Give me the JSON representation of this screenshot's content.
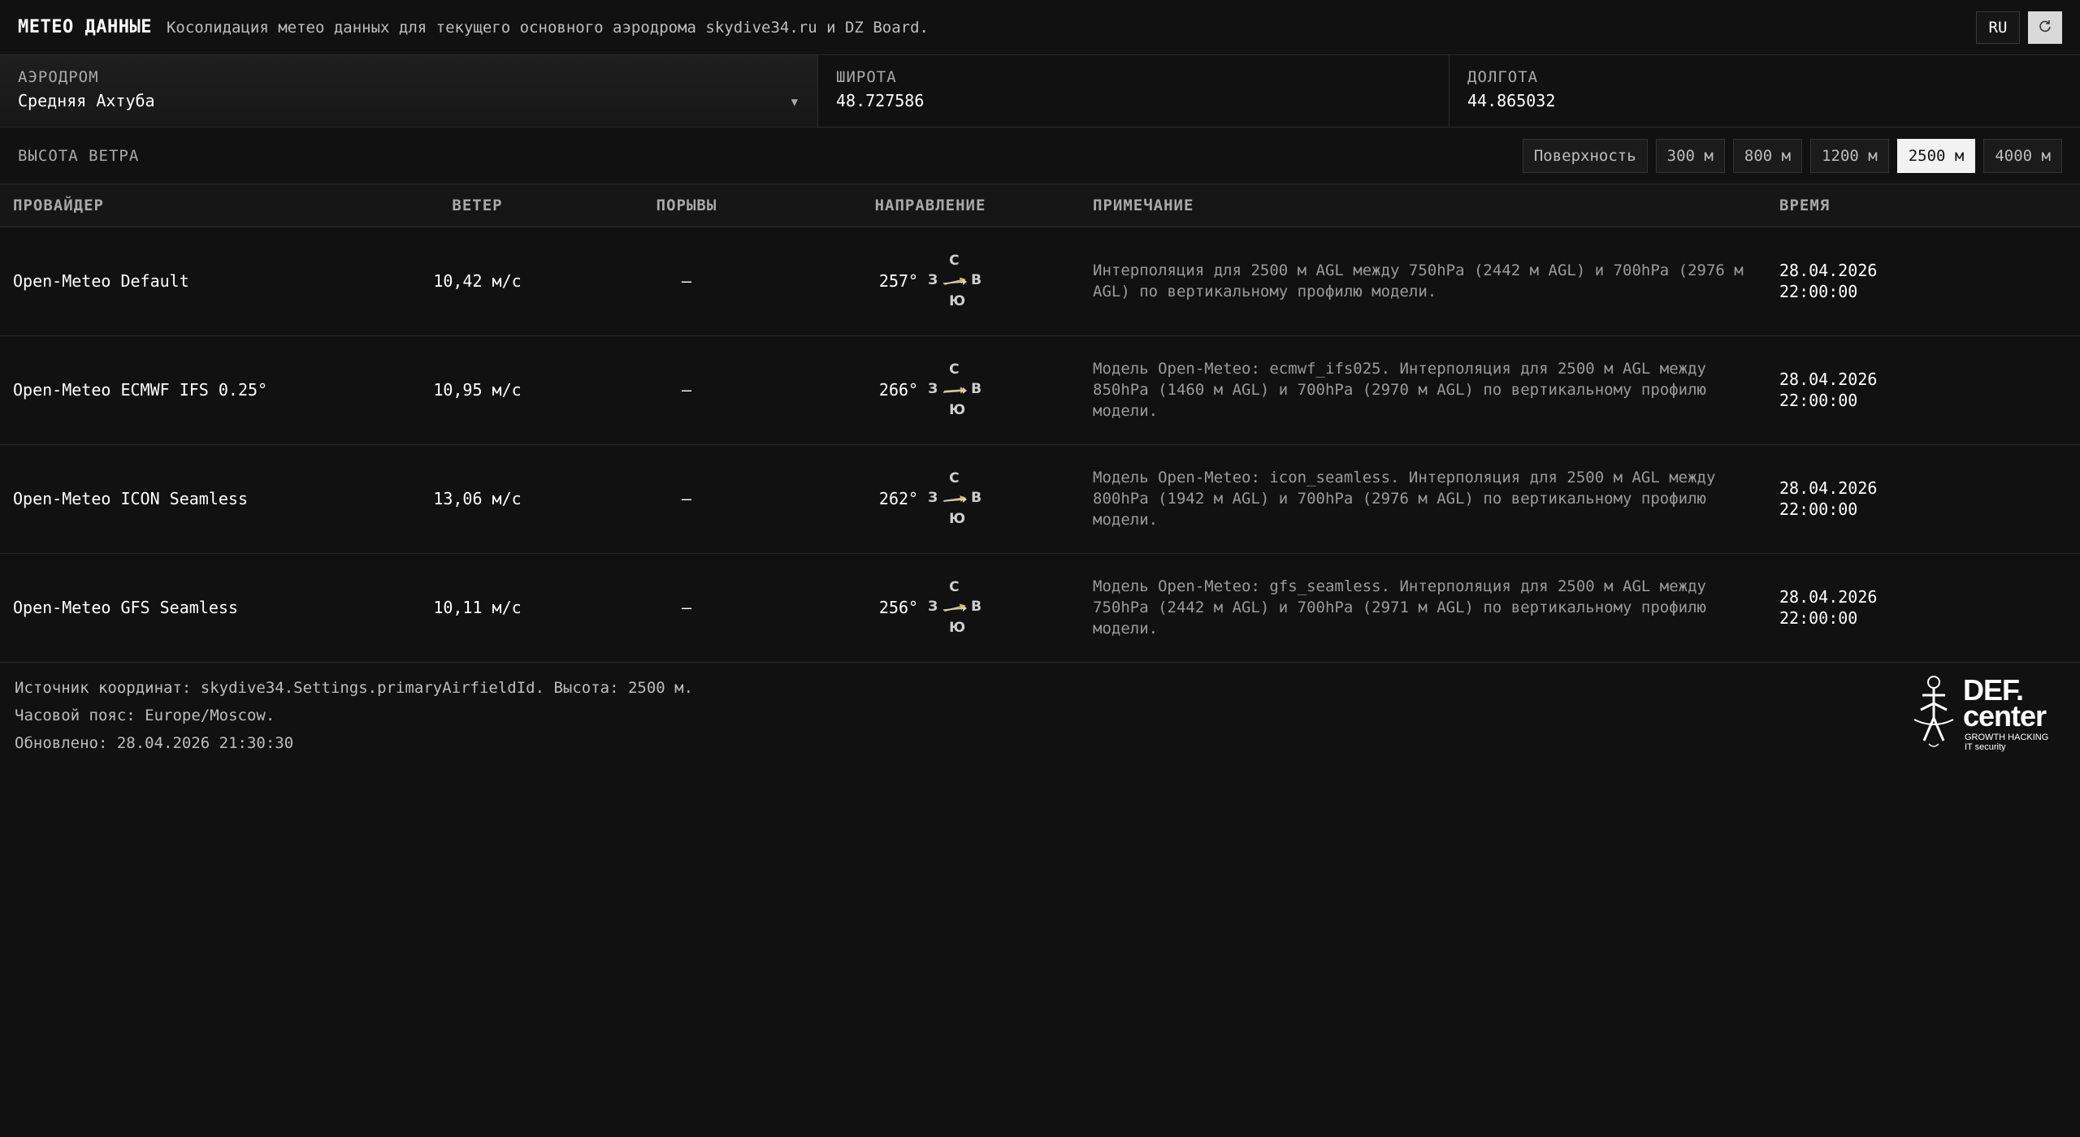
{
  "header": {
    "title": "МЕТЕО ДАННЫЕ",
    "subtitle": "Косолидация метео данных для текущего основного аэродрома skydive34.ru и DZ Board.",
    "lang_button": "RU",
    "refresh_icon": "refresh-icon"
  },
  "location": {
    "airfield_label": "АЭРОДРОМ",
    "airfield_value": "Средняя Ахтуба",
    "latitude_label": "ШИРОТА",
    "latitude_value": "48.727586",
    "longitude_label": "ДОЛГОТА",
    "longitude_value": "44.865032"
  },
  "altitude": {
    "label": "ВЫСОТА ВЕТРА",
    "options": [
      "Поверхность",
      "300 м",
      "800 м",
      "1200 м",
      "2500 м",
      "4000 м"
    ],
    "selected": "2500 м"
  },
  "table": {
    "headers": {
      "provider": "ПРОВАЙДЕР",
      "wind": "ВЕТЕР",
      "gusts": "ПОРЫВЫ",
      "direction": "НАПРАВЛЕНИЕ",
      "note": "ПРИМЕЧАНИЕ",
      "time": "ВРЕМЯ"
    },
    "compass": {
      "n": "С",
      "s": "Ю",
      "w": "З",
      "e": "В"
    },
    "rows": [
      {
        "provider": "Open-Meteo Default",
        "wind": "10,42 м/с",
        "gusts": "—",
        "direction_text": "257°",
        "direction_deg": 257,
        "note": "Интерполяция для 2500 м AGL между 750hPa (2442 м AGL) и 700hPa (2976 м AGL) по вертикальному профилю модели.",
        "date": "28.04.2026",
        "time": "22:00:00"
      },
      {
        "provider": "Open-Meteo ECMWF IFS 0.25°",
        "wind": "10,95 м/с",
        "gusts": "—",
        "direction_text": "266°",
        "direction_deg": 266,
        "note": "Модель Open-Meteo: ecmwf_ifs025. Интерполяция для 2500 м AGL между 850hPa (1460 м AGL) и 700hPa (2970 м AGL) по вертикальному профилю модели.",
        "date": "28.04.2026",
        "time": "22:00:00"
      },
      {
        "provider": "Open-Meteo ICON Seamless",
        "wind": "13,06 м/с",
        "gusts": "—",
        "direction_text": "262°",
        "direction_deg": 262,
        "note": "Модель Open-Meteo: icon_seamless. Интерполяция для 2500 м AGL между 800hPa (1942 м AGL) и 700hPa (2976 м AGL) по вертикальному профилю модели.",
        "date": "28.04.2026",
        "time": "22:00:00"
      },
      {
        "provider": "Open-Meteo GFS Seamless",
        "wind": "10,11 м/с",
        "gusts": "—",
        "direction_text": "256°",
        "direction_deg": 256,
        "note": "Модель Open-Meteo: gfs_seamless. Интерполяция для 2500 м AGL между 750hPa (2442 м AGL) и 700hPa (2971 м AGL) по вертикальному профилю модели.",
        "date": "28.04.2026",
        "time": "22:00:00"
      }
    ]
  },
  "footer": {
    "source": "Источник координат: skydive34.Settings.primaryAirfieldId. Высота: 2500 м.",
    "timezone": "Часовой пояс: Europe/Moscow.",
    "updated": "Обновлено: 28.04.2026 21:30:30"
  },
  "logo": {
    "line1": "DEF.",
    "line2": "center",
    "sub1": "GROWTH HACKING",
    "sub2": "IT security"
  },
  "colors": {
    "background": "#111111",
    "arrow": "#e0b95a",
    "active_button": "#f2f2f2"
  }
}
